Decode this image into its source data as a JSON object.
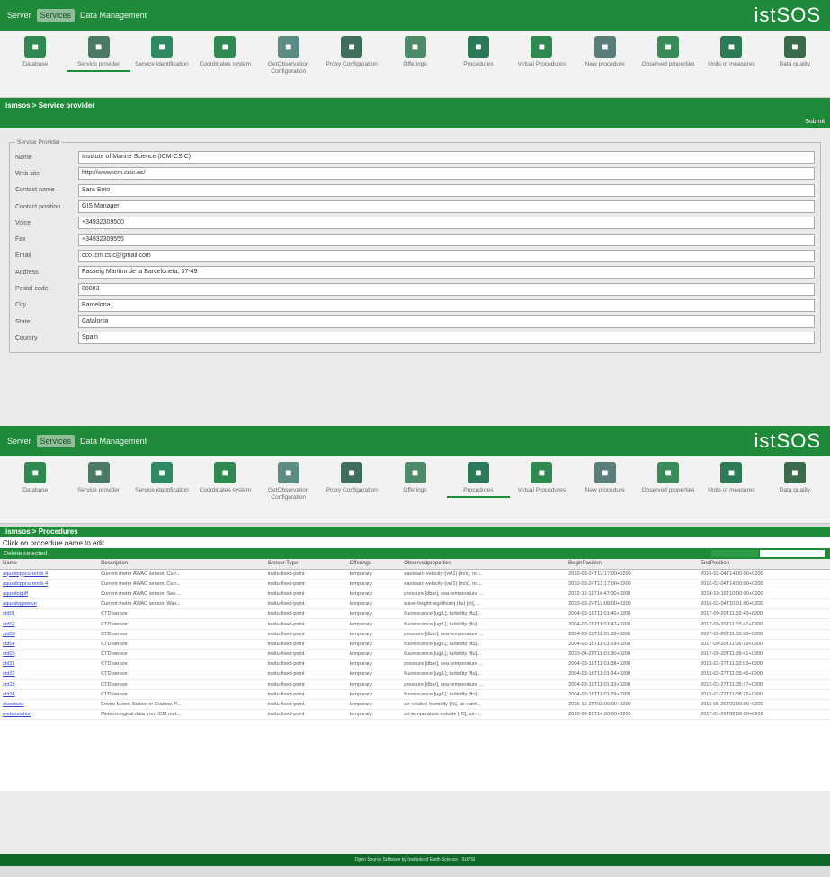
{
  "menu": [
    "Server",
    "Services",
    "Data Management"
  ],
  "logo": "istSOS",
  "icons": [
    {
      "label": "Database",
      "color": "#2f8a52"
    },
    {
      "label": "Service provider",
      "color": "#4a7a66"
    },
    {
      "label": "Service identification",
      "color": "#2e8a62"
    },
    {
      "label": "Coordinates system",
      "color": "#2f8a52"
    },
    {
      "label": "GetObservation Configuration",
      "color": "#5c8c86"
    },
    {
      "label": "Proxy Configuration",
      "color": "#3f6f5a"
    },
    {
      "label": "Offerings",
      "color": "#4e8a6a"
    },
    {
      "label": "Procedures",
      "color": "#2a7a5a"
    },
    {
      "label": "Virtual Procedures",
      "color": "#2f8a52"
    },
    {
      "label": "New procedure",
      "color": "#5a7e7a"
    },
    {
      "label": "Observed properties",
      "color": "#3a8a5a"
    },
    {
      "label": "Units of measures",
      "color": "#2b7c55"
    },
    {
      "label": "Data quality",
      "color": "#3a6b4a"
    }
  ],
  "panel1": {
    "breadcrumb": "ismsos > Service provider",
    "submit": "Submit",
    "legend": "Service Provider",
    "fields": [
      {
        "label": "Name",
        "value": "Institute of Marine Science (ICM-CSIC)"
      },
      {
        "label": "Web site",
        "value": "http://www.icm.csic.es/"
      },
      {
        "label": "Contact name",
        "value": "Sara Soto"
      },
      {
        "label": "Contact position",
        "value": "GIS Manager"
      },
      {
        "label": "Voice",
        "value": "+34932309500"
      },
      {
        "label": "Fax",
        "value": "+34932309555"
      },
      {
        "label": "Email",
        "value": "cco.icm.csic@gmail.com"
      },
      {
        "label": "Address",
        "value": "Passeig Marítim de la Barceloneta, 37-49"
      },
      {
        "label": "Postal code",
        "value": "08003"
      },
      {
        "label": "City",
        "value": "Barcelona"
      },
      {
        "label": "State",
        "value": "Catalonia"
      },
      {
        "label": "Country",
        "value": "Spain"
      }
    ]
  },
  "panel2": {
    "breadcrumb": "ismsos > Procedures",
    "hint": "Click on procedure name to edit",
    "delete": "Delete selected",
    "columns": [
      "Name",
      "Description",
      "Sensor Type",
      "Offerings",
      "Observedproperties",
      "BeginPosition",
      "EndPosition"
    ],
    "rows": [
      [
        "aquadoppcurrentb.4",
        "Current meter AWAC sensor, Curr...",
        "insitu-fixed-point",
        "temporary",
        "eastward-velocity-(vel1) [m/s], no...",
        "2010-03-24T12:17:00+0200",
        "2016-03-04T14:00:00+0200"
      ],
      [
        "aquadoppcurrentb.4",
        "Current meter AWAC sensor, Curr...",
        "insitu-fixed-point",
        "temporary",
        "eastward-velocity-(vel1) [m/s], no...",
        "2010-03-24T12:17:00+0200",
        "2016-03-04T14:00:00+0200"
      ],
      [
        "aquadoppff",
        "Current meter AWAC sensor, Sea ...",
        "insitu-fixed-point",
        "temporary",
        "pressure [dbar], sea-temperature ...",
        "2012-12-11T14:47:00+0200",
        "2014-10-16T10:00:00+0200"
      ],
      [
        "aquadoppwave",
        "Current meter AWAC sensor, Wav...",
        "insitu-fixed-point",
        "temporary",
        "wave-height-significant (hs) [m], ...",
        "2010-03-24T12:08:00+0200",
        "2016-03-04T10:01:00+0200"
      ],
      [
        "ctd01",
        "CTD sensor",
        "insitu-fixed-point",
        "temporary",
        "fluorescence [ug/L], turbidity [ftu]...",
        "2004-03-15T11:01:40+0200",
        "2017-09-20T11:02:40+0200"
      ],
      [
        "ctd02",
        "CTD sensor",
        "insitu-fixed-point",
        "temporary",
        "fluorescence [ug/L], turbidity [ftu]...",
        "2004-03-15T11:01:47+0200",
        "2017-09-20T11:03:47+0200"
      ],
      [
        "ctd03",
        "CTD sensor",
        "insitu-fixed-point",
        "temporary",
        "pressure [dbar], sea-temperature ...",
        "2004-03-15T11:01:32+0200",
        "2017-09-20T11:03:56+0200"
      ],
      [
        "ctd04",
        "CTD sensor",
        "insitu-fixed-point",
        "temporary",
        "fluorescence [ug/L], turbidity [ftu]...",
        "2004-03-15T11:01:29+0200",
        "2017-09-20T11:06:19+0200"
      ],
      [
        "ctd05",
        "CTD sensor",
        "insitu-fixed-point",
        "temporary",
        "fluorescence [ug/L], turbidity [ftu]...",
        "2010-04-20T11:01:30+0200",
        "2017-09-20T11:09:41+0200"
      ],
      [
        "ctd21",
        "CTD sensor",
        "insitu-fixed-point",
        "temporary",
        "pressure [dbar], sea-temperature ...",
        "2004-03-15T11:01:38+0200",
        "2015-03-27T11:02:03+0200"
      ],
      [
        "ctd22",
        "CTD sensor",
        "insitu-fixed-point",
        "temporary",
        "fluorescence [ug/L], turbidity [ftu]...",
        "2004-03-15T11:01:34+0200",
        "2015-03-27T11:03:46+0200"
      ],
      [
        "ctd23",
        "CTD sensor",
        "insitu-fixed-point",
        "temporary",
        "pressure [dbar], sea-temperature ...",
        "2004-03-15T11:01:33+0200",
        "2015-03-27T11:05:17+0200"
      ],
      [
        "ctd24",
        "CTD sensor",
        "insitu-fixed-point",
        "temporary",
        "fluorescence [ug/L], turbidity [ftu]...",
        "2004-03-15T11:01:29+0200",
        "2015-03-27T11:08:12+0200"
      ],
      [
        "okwatcae",
        "Enviro Meteo Station in Gratiow, P...",
        "insitu-fixed-point",
        "temporary",
        "air-relative-humidity [%], air-rainf...",
        "2015-10-20T02:00:00+0200",
        "2016-05-26T00:00:00+0200"
      ],
      [
        "meteostation",
        "Meteorological data from ICM met...",
        "insitu-fixed-point",
        "temporary",
        "air-temperature-outside [°C], air-t...",
        "2010-09-22T14:00:00+0200",
        "2017-01-01T02:00:00+0200"
      ]
    ]
  },
  "footer": "Open Source Software by Institute of Earth Science - SUPSI"
}
